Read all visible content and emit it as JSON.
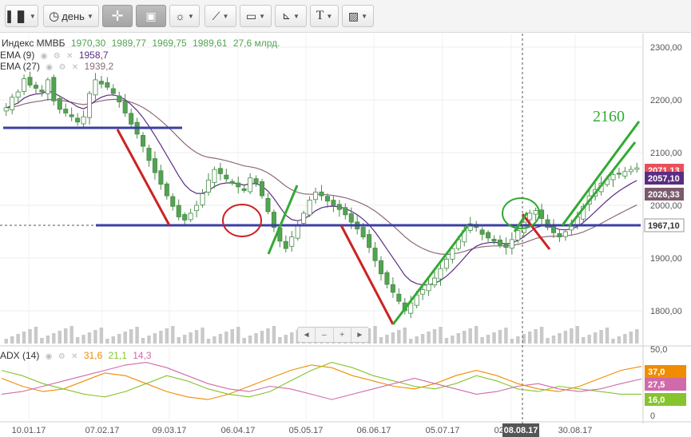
{
  "toolbar": {
    "period_label": "день",
    "text_tool_label": "T"
  },
  "legend": {
    "symbol": "Индекс ММВБ",
    "open": "1970,30",
    "high": "1989,77",
    "low": "1969,75",
    "close": "1989,61",
    "volume": "27,6 млрд.",
    "ema9_label": "EMA (9)",
    "ema9_value": "1958,7",
    "ema27_label": "EMA (27)",
    "ema27_value": "1939,2",
    "adx_label": "ADX (14)",
    "adx_value": "31,6",
    "pdi_value": "21,1",
    "mdi_value": "14,3"
  },
  "annotation_2160": "2160",
  "navigator": [
    "◄",
    "–",
    "+",
    "►"
  ],
  "colors": {
    "candle": "#52a352",
    "ema9": "#5a2d82",
    "ema27": "#8c6a78",
    "support_line": "#3b3fa3",
    "down_trend": "#cc2222",
    "up_trend": "#33aa33",
    "adx": "#f08c00",
    "pdi": "#86c42e",
    "mdi": "#d06aa8",
    "price_tag_close": "#e8505b",
    "price_tag_ema9": "#5a2d82",
    "price_tag_ema27": "#7a5a6e"
  },
  "chart_data": [
    {
      "type": "candlestick",
      "title": "Индекс ММВБ",
      "xlabel": "",
      "ylabel": "",
      "x_ticks": [
        "10.01.17",
        "07.02.17",
        "09.03.17",
        "06.04.17",
        "05.05.17",
        "06.06.17",
        "05.07.17",
        "02.08.17",
        "08.08.17",
        "30.08.17"
      ],
      "y_ticks": [
        "2300,00",
        "2200,00",
        "2100,00",
        "2000,00",
        "1900,00",
        "1800,00"
      ],
      "ylim": [
        1770,
        2315
      ],
      "price_tags": [
        "2071,13",
        "2057,10",
        "2026,33",
        "1967,10"
      ],
      "series": [
        {
          "name": "Индекс ММВБ",
          "values": [
            2185,
            2205,
            2215,
            2240,
            2228,
            2222,
            2215,
            2238,
            2198,
            2182,
            2175,
            2168,
            2158,
            2168,
            2212,
            2238,
            2230,
            2224,
            2212,
            2196,
            2175,
            2154,
            2135,
            2112,
            2085,
            2062,
            2040,
            2018,
            1998,
            1978,
            1972,
            1985,
            2000,
            2022,
            2048,
            2068,
            2060,
            2050,
            2042,
            2035,
            2028,
            2052,
            2042,
            2018,
            1988,
            1958,
            1932,
            1918,
            1940,
            1962,
            1985,
            2010,
            2025,
            2018,
            2008,
            2000,
            1992,
            1982,
            1968,
            1955,
            1940,
            1920,
            1895,
            1870,
            1850,
            1835,
            1818,
            1800,
            1815,
            1830,
            1840,
            1850,
            1862,
            1880,
            1898,
            1918,
            1935,
            1952,
            1965,
            1958,
            1945,
            1938,
            1932,
            1925,
            1920,
            1935,
            1952,
            1968,
            1985,
            1990,
            1975,
            1958,
            1948,
            1940,
            1950,
            1962,
            1978,
            1998,
            2018,
            2030,
            2042,
            2050,
            2058,
            2060,
            2064,
            2068,
            2071
          ]
        },
        {
          "name": "EMA (9)",
          "values": []
        },
        {
          "name": "EMA (27)",
          "values": []
        }
      ]
    },
    {
      "type": "line",
      "title": "ADX (14)",
      "xlabel": "",
      "ylabel": "",
      "y_ticks": [
        "50,0",
        "25,0",
        "0"
      ],
      "ylim": [
        0,
        50
      ],
      "value_tags": [
        "37,0",
        "27,5",
        "16,0"
      ],
      "series": [
        {
          "name": "ADX",
          "values": [
            28,
            22,
            18,
            20,
            26,
            32,
            30,
            24,
            18,
            14,
            12,
            16,
            22,
            28,
            34,
            38,
            36,
            30,
            26,
            22,
            20,
            24,
            30,
            34,
            30,
            24,
            20,
            18,
            22,
            28,
            34,
            37
          ]
        },
        {
          "name": "+DI",
          "values": [
            34,
            30,
            24,
            20,
            16,
            14,
            18,
            24,
            30,
            26,
            20,
            16,
            14,
            18,
            26,
            34,
            40,
            36,
            30,
            26,
            22,
            20,
            24,
            30,
            26,
            20,
            18,
            22,
            20,
            18,
            16,
            16
          ]
        },
        {
          "name": "-DI",
          "values": [
            16,
            18,
            22,
            26,
            30,
            34,
            38,
            40,
            36,
            30,
            24,
            20,
            18,
            22,
            20,
            16,
            12,
            16,
            20,
            24,
            28,
            24,
            20,
            16,
            18,
            22,
            24,
            20,
            18,
            20,
            24,
            27.5
          ]
        }
      ]
    }
  ]
}
